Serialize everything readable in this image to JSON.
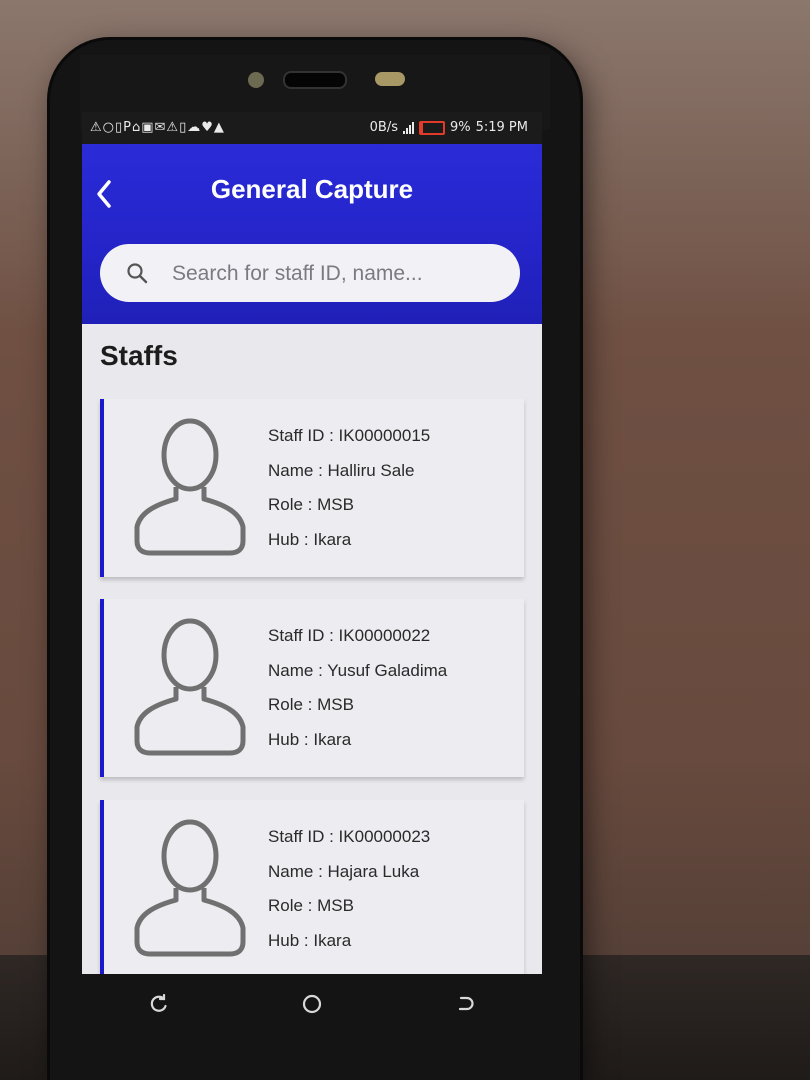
{
  "status_bar": {
    "notification_icons": "⚠○▯P⌂▣✉⚠▯☁♥▲",
    "network_speed": "0B/s",
    "battery_percent": "9%",
    "time": "5:19 PM",
    "battery_color": "#e23b2a"
  },
  "app_bar": {
    "title": "General Capture",
    "back_icon": "chevron-left-icon",
    "accent_color": "#2424c8"
  },
  "search": {
    "placeholder": "Search for staff ID, name...",
    "value": ""
  },
  "staff_section": {
    "title": "Staffs",
    "items": [
      {
        "staff_id": "Staff ID : IK00000015",
        "name": "Name : Halliru Sale",
        "role": "Role : MSB",
        "hub": "Hub : Ikara"
      },
      {
        "staff_id": "Staff ID : IK00000022",
        "name": "Name : Yusuf Galadima",
        "role": "Role : MSB",
        "hub": "Hub : Ikara"
      },
      {
        "staff_id": "Staff ID : IK00000023",
        "name": "Name : Hajara Luka",
        "role": "Role : MSB",
        "hub": "Hub : Ikara"
      }
    ]
  },
  "nav_bar": {
    "icons": [
      "recent-apps-icon",
      "home-icon",
      "back-icon"
    ]
  }
}
